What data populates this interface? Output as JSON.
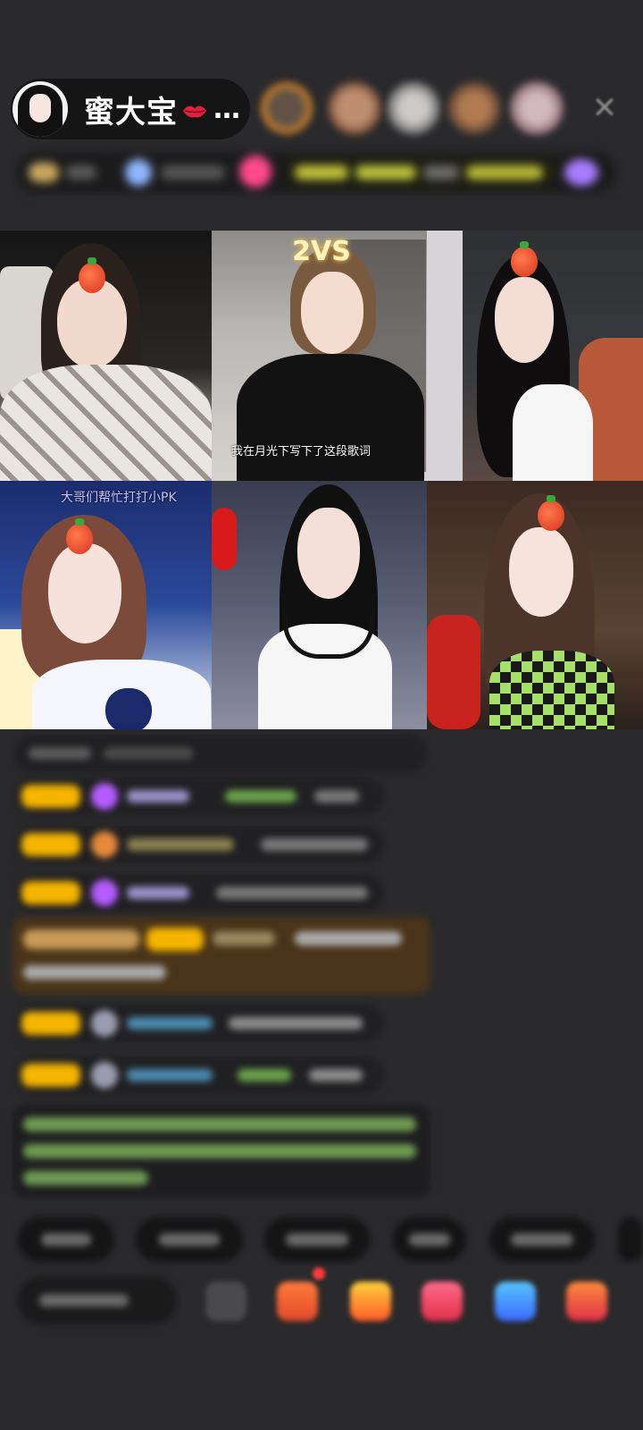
{
  "header": {
    "host_name": "蜜大宝",
    "more": "…",
    "close_glyph": "✕"
  },
  "grid": {
    "cells": [
      {
        "caption": ""
      },
      {
        "caption": "我在月光下写下了这段歌词",
        "badge": "2VS"
      },
      {
        "caption": ""
      },
      {
        "caption": "大哥们帮忙打打小PK"
      },
      {
        "caption": ""
      },
      {
        "caption": ""
      }
    ]
  },
  "icons": {
    "kiss": "kiss-lips-icon",
    "tomato": "tomato-sticker-icon",
    "close": "close-icon"
  },
  "colors": {
    "background": "#2a2a2c",
    "host_pill": "#151516",
    "level_badge": "#f5b400",
    "purple_diamond": "#b45cff"
  }
}
